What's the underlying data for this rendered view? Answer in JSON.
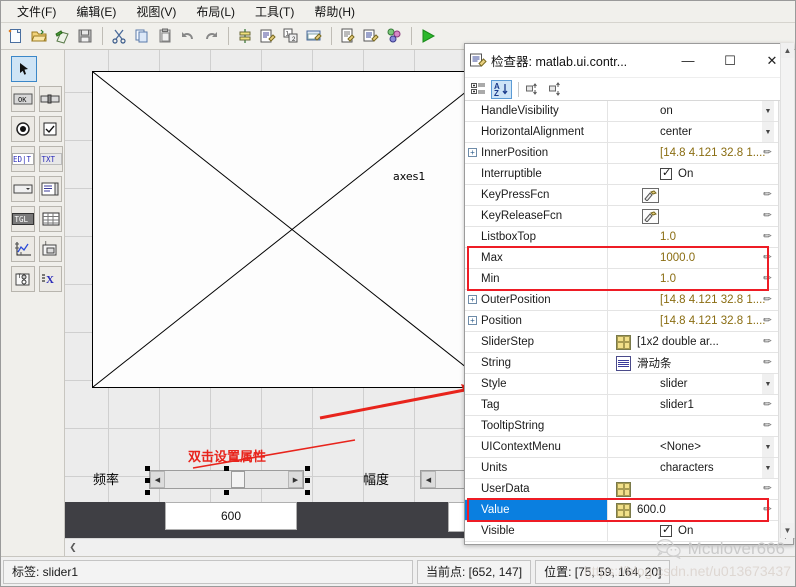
{
  "menubar": {
    "items": [
      {
        "label": "文件(F)",
        "name": "menu-file"
      },
      {
        "label": "编辑(E)",
        "name": "menu-edit"
      },
      {
        "label": "视图(V)",
        "name": "menu-view"
      },
      {
        "label": "布局(L)",
        "name": "menu-layout"
      },
      {
        "label": "工具(T)",
        "name": "menu-tools"
      },
      {
        "label": "帮助(H)",
        "name": "menu-help"
      }
    ]
  },
  "toolbar": {
    "buttons": [
      {
        "icon": "new-file-icon"
      },
      {
        "icon": "open-folder-icon"
      },
      {
        "icon": "export-icon"
      },
      {
        "icon": "save-icon"
      },
      {
        "icon": "cut-icon"
      },
      {
        "icon": "copy-icon"
      },
      {
        "icon": "paste-icon"
      },
      {
        "icon": "undo-icon"
      },
      {
        "icon": "redo-icon"
      },
      {
        "icon": "align-icon"
      },
      {
        "icon": "menu-editor-icon"
      },
      {
        "icon": "tab-order-icon"
      },
      {
        "icon": "toolbar-editor-icon"
      },
      {
        "icon": "m-file-editor-icon"
      },
      {
        "icon": "property-inspector-icon"
      },
      {
        "icon": "object-browser-icon"
      },
      {
        "icon": "run-icon"
      }
    ]
  },
  "palette": {
    "tools": [
      {
        "name": "select-arrow-tool",
        "glyph": "arrow",
        "selected": true
      },
      {
        "name": "push-button-tool",
        "glyph": "OK"
      },
      {
        "name": "slider-tool",
        "glyph": "slider"
      },
      {
        "name": "radio-button-tool",
        "glyph": "radio"
      },
      {
        "name": "checkbox-tool",
        "glyph": "check"
      },
      {
        "name": "edit-text-tool",
        "glyph": "ED|T"
      },
      {
        "name": "static-text-tool",
        "glyph": "TXT"
      },
      {
        "name": "popup-menu-tool",
        "glyph": "popup"
      },
      {
        "name": "listbox-tool",
        "glyph": "listbox"
      },
      {
        "name": "toggle-button-tool",
        "glyph": "TGL"
      },
      {
        "name": "table-tool",
        "glyph": "table"
      },
      {
        "name": "axes-tool",
        "glyph": "axes"
      },
      {
        "name": "panel-tool",
        "glyph": "panel"
      },
      {
        "name": "button-group-tool",
        "glyph": "buttongroup"
      },
      {
        "name": "activex-tool",
        "glyph": "X"
      }
    ]
  },
  "canvas": {
    "axes_label": "axes1",
    "frequency_label": "频率",
    "amplitude_label": "幅度",
    "edit_value": "600",
    "annotation": "双击设置属性"
  },
  "inspector": {
    "title": "检查器:  matlab.ui.contr...",
    "title_icon": "inspector-icon",
    "window_buttons": {
      "minimize": "—",
      "maximize": "☐",
      "close": "✕"
    },
    "toolbar": {
      "categorize_label": "categorized-view",
      "alphabetic_label": "alphabetic-sort",
      "expand_label": "expand-all",
      "collapse_label": "collapse-all"
    },
    "properties": [
      {
        "name": "HandleVisibility",
        "value": "on",
        "control": "dropdown",
        "expand": false
      },
      {
        "name": "HorizontalAlignment",
        "value": "center",
        "control": "dropdown",
        "expand": false
      },
      {
        "name": "InnerPosition",
        "value": "[14.8 4.121 32.8 1....",
        "control": "numeric",
        "expand": true
      },
      {
        "name": "Interruptible",
        "value": "On",
        "control": "checkbox",
        "expand": false
      },
      {
        "name": "KeyPressFcn",
        "value": "",
        "control": "function",
        "expand": false
      },
      {
        "name": "KeyReleaseFcn",
        "value": "",
        "control": "function",
        "expand": false
      },
      {
        "name": "ListboxTop",
        "value": "1.0",
        "control": "numeric",
        "expand": false
      },
      {
        "name": "Max",
        "value": "1000.0",
        "control": "numeric",
        "expand": false,
        "highlight": true
      },
      {
        "name": "Min",
        "value": "1.0",
        "control": "numeric",
        "expand": false,
        "highlight": true
      },
      {
        "name": "OuterPosition",
        "value": "[14.8 4.121 32.8 1....",
        "control": "numeric",
        "expand": true
      },
      {
        "name": "Position",
        "value": "[14.8 4.121 32.8 1....",
        "control": "numeric",
        "expand": true
      },
      {
        "name": "SliderStep",
        "value": "[1x2  double ar...",
        "control": "grid",
        "expand": false
      },
      {
        "name": "String",
        "value": "滑动条",
        "control": "string",
        "expand": false
      },
      {
        "name": "Style",
        "value": "slider",
        "control": "dropdown",
        "expand": false
      },
      {
        "name": "Tag",
        "value": "slider1",
        "control": "text",
        "expand": false
      },
      {
        "name": "TooltipString",
        "value": "",
        "control": "text",
        "expand": false
      },
      {
        "name": "UIContextMenu",
        "value": "<None>",
        "control": "dropdown",
        "expand": false
      },
      {
        "name": "Units",
        "value": "characters",
        "control": "dropdown",
        "expand": false
      },
      {
        "name": "UserData",
        "value": "",
        "control": "grid",
        "expand": false
      },
      {
        "name": "Value",
        "value": "600.0",
        "control": "grid",
        "expand": false,
        "selected": true,
        "highlight": true
      },
      {
        "name": "Visible",
        "value": "On",
        "control": "checkbox",
        "expand": false
      }
    ]
  },
  "statusbar": {
    "tag_label": "标签: slider1",
    "current_point_label": "当前点:  [652, 147]",
    "position_label": "位置: [75, 59, 164, 20]"
  },
  "watermark": {
    "text": "Mculover666",
    "url": "https://blog.csdn.net/u013673437"
  },
  "colors": {
    "accent": "#0a7fe0",
    "highlight": "#ee1c25",
    "annotation": "#e8241c",
    "numeric": "#8a6d12"
  }
}
